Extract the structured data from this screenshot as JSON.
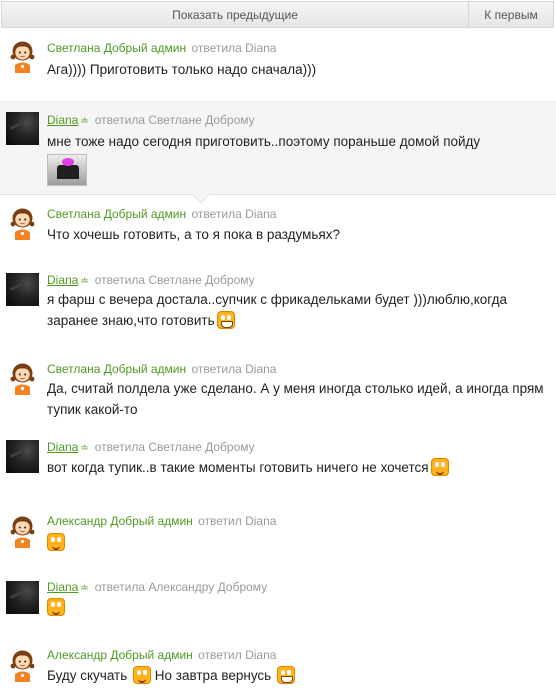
{
  "toolbar": {
    "show_previous": "Показать предыдущие",
    "to_first": "К первым"
  },
  "icons": {
    "user_avatar": "girl-avatar-icon",
    "dark_avatar": "dark-photo-avatar",
    "online": "online-status-icon",
    "smiley": "smiley-icon",
    "grin": "grin-smiley-icon",
    "photo": "photo-thumbnail"
  },
  "colors": {
    "author_name": "#4e9a22",
    "muted": "#9a9a9a",
    "highlight_bg": "#f5f5f5",
    "button_bg": "#eeeeee"
  },
  "messages": [
    {
      "author": "Светлана Добрый админ",
      "verb": "ответила",
      "target": "Diana",
      "text": "Ага)))) Приготовить только надо сначала)))"
    },
    {
      "author": "Diana",
      "online": "≐",
      "verb": "ответила",
      "target": "Светлане Доброму",
      "text": "мне тоже надо сегодня приготовить..поэтому пораньше домой пойду"
    },
    {
      "author": "Светлана Добрый админ",
      "verb": "ответила",
      "target": "Diana",
      "text": "Что хочешь готовить, а то я пока в раздумьях?"
    },
    {
      "author": "Diana",
      "online": "≐",
      "verb": "ответила",
      "target": "Светлане Доброму",
      "text": "я фарш с вечера достала..супчик с фрикадельками будет )))люблю,когда заранее знаю,что готовить"
    },
    {
      "author": "Светлана Добрый админ",
      "verb": "ответила",
      "target": "Diana",
      "text": "Да, считай полдела уже сделано. А у меня иногда столько идей, а иногда прям тупик какой-то"
    },
    {
      "author": "Diana",
      "online": "≐",
      "verb": "ответила",
      "target": "Светлане Доброму",
      "text": "вот когда тупик..в такие моменты готовить ничего не хочется"
    },
    {
      "author": "Александр Добрый админ",
      "verb": "ответил",
      "target": "Diana",
      "text": ""
    },
    {
      "author": "Diana",
      "online": "≐",
      "verb": "ответила",
      "target": "Александру Доброму",
      "text": ""
    },
    {
      "author": "Александр Добрый админ",
      "verb": "ответил",
      "target": "Diana",
      "text_a": "Буду скучать",
      "text_b": "Но завтра вернусь"
    }
  ]
}
